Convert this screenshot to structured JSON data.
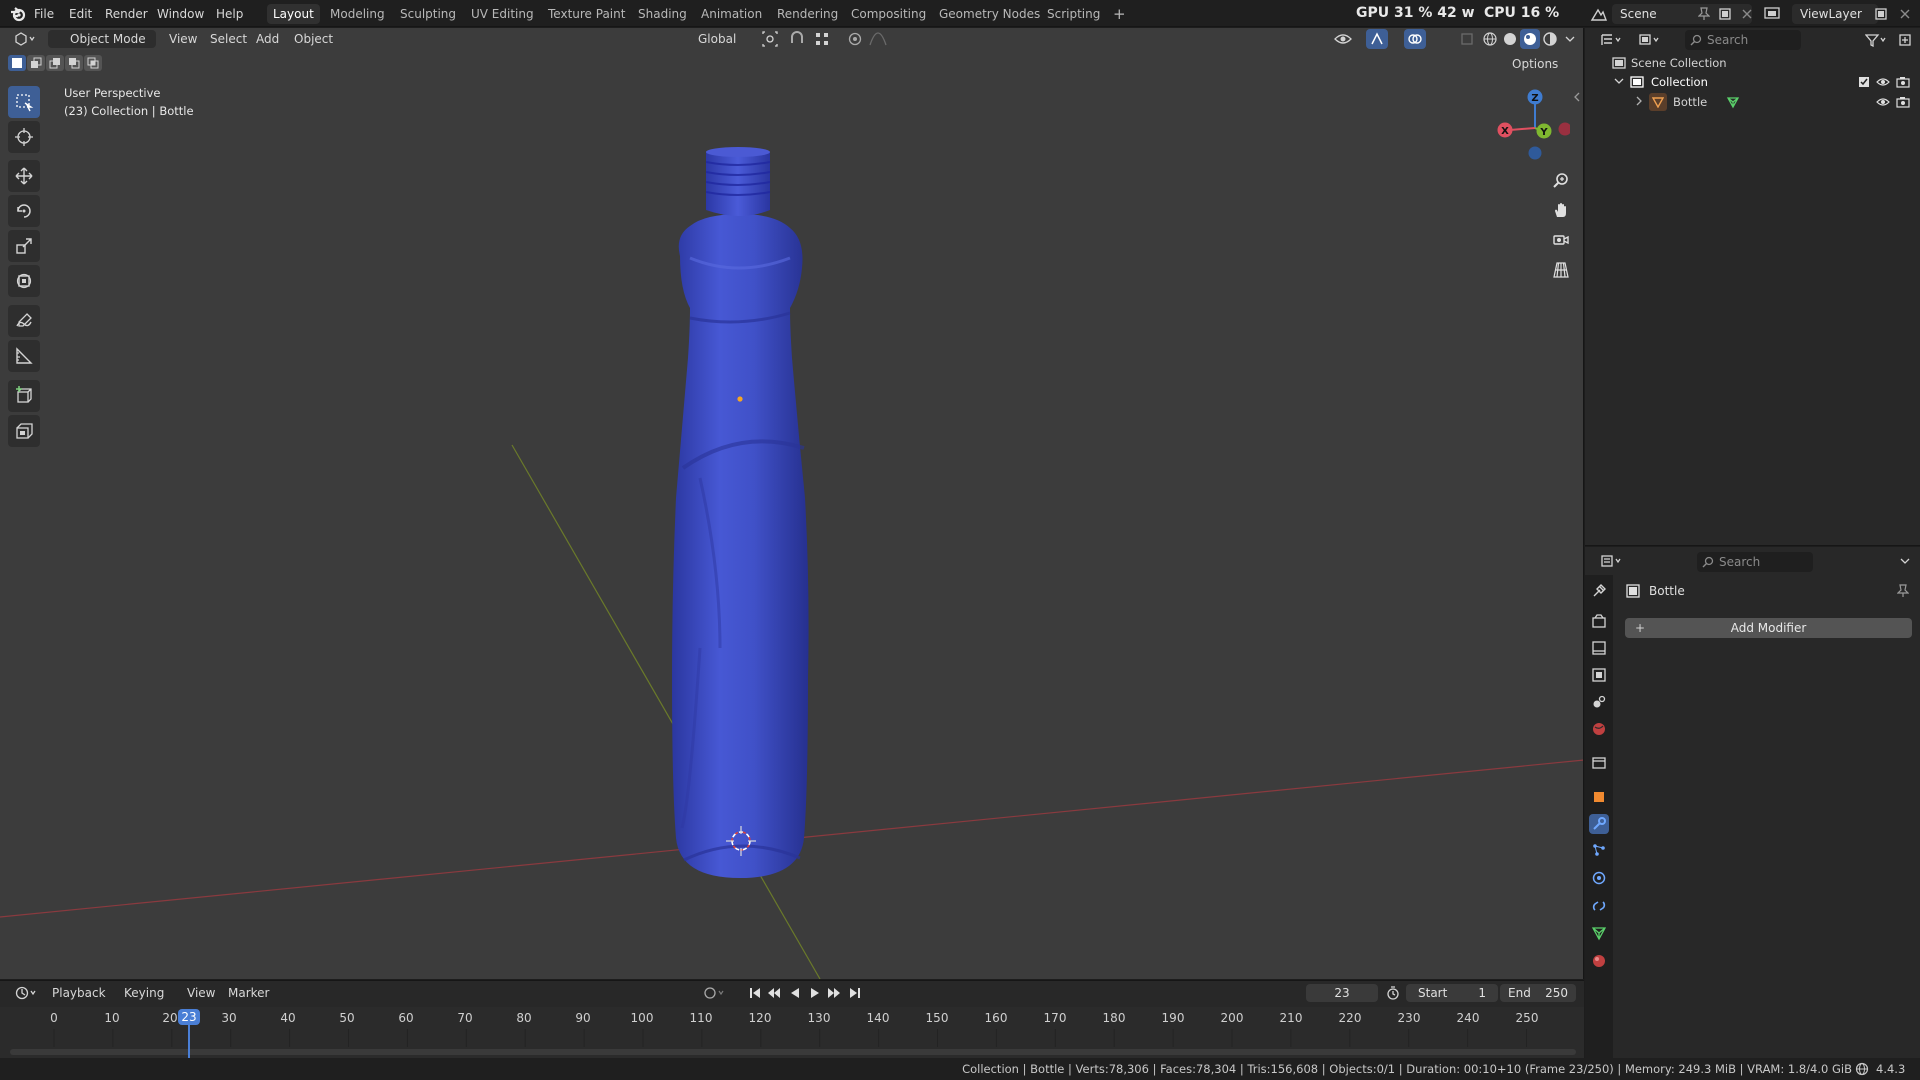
{
  "menu": {
    "items": [
      "File",
      "Edit",
      "Render",
      "Window",
      "Help"
    ]
  },
  "workspaces": {
    "tabs": [
      "Layout",
      "Modeling",
      "Sculpting",
      "UV Editing",
      "Texture Paint",
      "Shading",
      "Animation",
      "Rendering",
      "Compositing",
      "Geometry Nodes",
      "Scripting"
    ],
    "add_label": "+"
  },
  "stats": {
    "gpu": "GPU 31 % 42 w",
    "cpu": "CPU 16 %"
  },
  "scene": {
    "name": "Scene",
    "view_layer": "ViewLayer"
  },
  "viewport": {
    "mode": "Object Mode",
    "menus": [
      "View",
      "Select",
      "Add",
      "Object"
    ],
    "transform_orientation": "Global",
    "options_label": "Options",
    "perspective": "User Perspective",
    "context": "(23) Collection | Bottle",
    "gizmo": {
      "x": "X",
      "y": "Y",
      "z": "Z"
    },
    "object_color": "#3e4fc4"
  },
  "outliner": {
    "search_placeholder": "Search",
    "scene_collection": "Scene Collection",
    "collection": "Collection",
    "object": "Bottle"
  },
  "properties": {
    "search_placeholder": "Search",
    "object_name": "Bottle",
    "add_modifier": "Add Modifier"
  },
  "timeline": {
    "menus": [
      "Playback",
      "Keying",
      "View",
      "Marker"
    ],
    "current_frame": "23",
    "start_label": "Start",
    "start_value": "1",
    "end_label": "End",
    "end_value": "250",
    "ruler": [
      "0",
      "10",
      "20",
      "30",
      "40",
      "50",
      "60",
      "70",
      "80",
      "90",
      "100",
      "110",
      "120",
      "130",
      "140",
      "150",
      "160",
      "170",
      "180",
      "190",
      "200",
      "210",
      "220",
      "230",
      "240",
      "250"
    ],
    "playhead_label": "23"
  },
  "statusbar": {
    "text": "Collection | Bottle | Verts:78,306 | Faces:78,304 | Tris:156,608 | Objects:0/1 | Duration: 00:10+10 (Frame 23/250) | Memory: 249.3 MiB | VRAM: 1.8/4.0 GiB",
    "version": "4.4.3"
  }
}
